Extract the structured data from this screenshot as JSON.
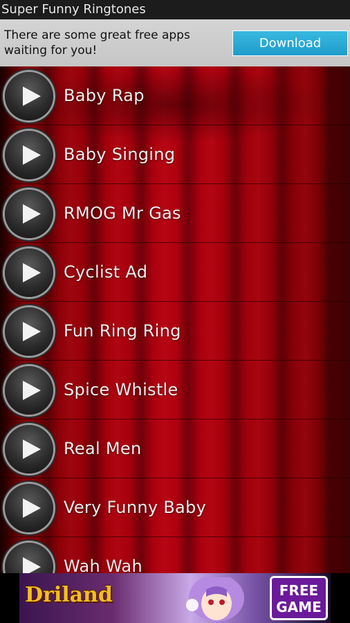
{
  "app": {
    "title": "Super Funny Ringtones"
  },
  "promo": {
    "text": "There are some great free apps waiting for you!",
    "download_label": "Download"
  },
  "ringtones": [
    {
      "label": "Baby Rap"
    },
    {
      "label": "Baby Singing"
    },
    {
      "label": "RMOG Mr Gas"
    },
    {
      "label": "Cyclist Ad"
    },
    {
      "label": "Fun Ring Ring"
    },
    {
      "label": "Spice Whistle"
    },
    {
      "label": "Real Men"
    },
    {
      "label": "Very Funny Baby"
    },
    {
      "label": "Wah Wah"
    }
  ],
  "ad": {
    "logo": "Driland",
    "badge_line1": "FREE",
    "badge_line2": "GAME"
  },
  "colors": {
    "accent_download": "#2aaad6",
    "curtain_red": "#a3000c"
  },
  "icons": {
    "row_action": "play-icon"
  }
}
